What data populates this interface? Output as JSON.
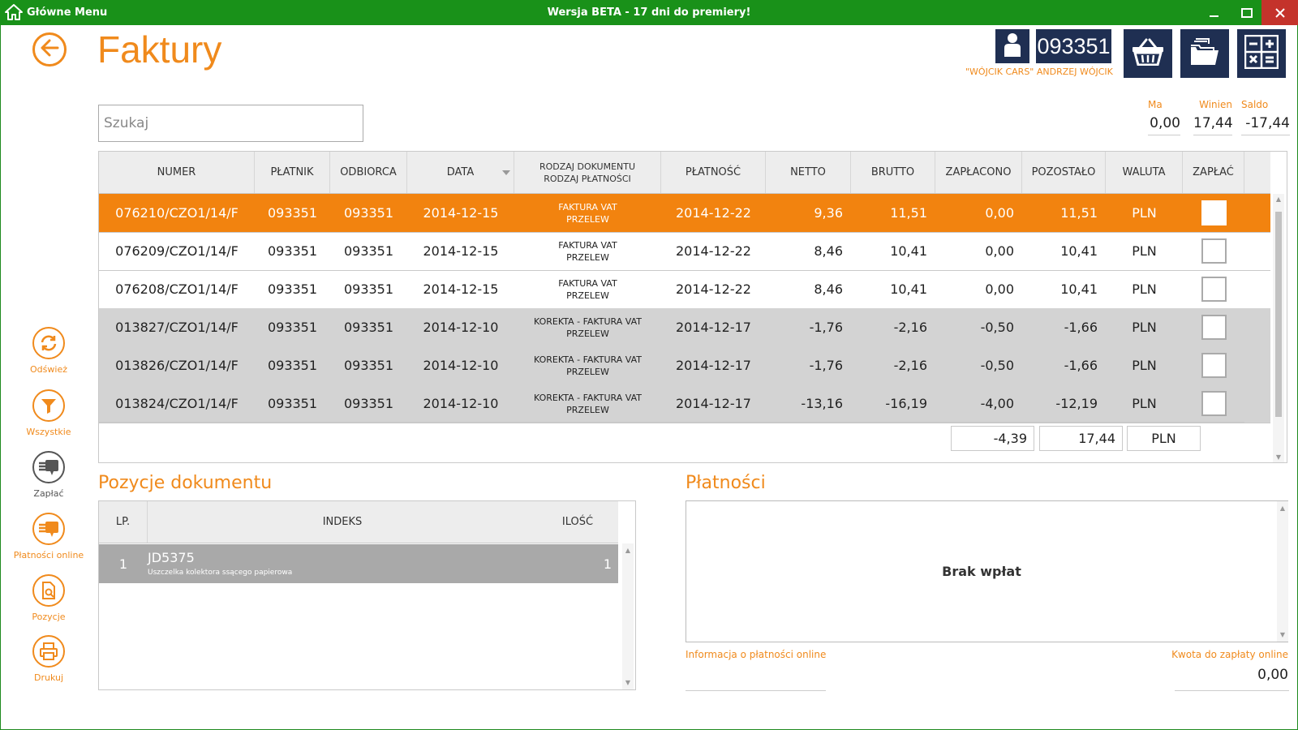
{
  "window": {
    "menu_label": "Główne Menu",
    "title": "Wersja BETA - 17 dni do premiery!"
  },
  "page": {
    "title": "Faktury"
  },
  "customer": {
    "code": "093351",
    "name": "\"WÓJCIK  CARS\" ANDRZEJ WÓJCIK"
  },
  "search": {
    "placeholder": "Szukaj"
  },
  "summary": {
    "ma_label": "Ma",
    "ma_value": "0,00",
    "winien_label": "Winien",
    "winien_value": "17,44",
    "saldo_label": "Saldo",
    "saldo_value": "-17,44"
  },
  "sidebar": {
    "refresh": "Odśwież",
    "all": "Wszystkie",
    "pay": "Zapłać",
    "online": "Płatności online",
    "positions": "Pozycje",
    "print": "Drukuj"
  },
  "invoices": {
    "headers": {
      "numer": "NUMER",
      "platnik": "PŁATNIK",
      "odbiorca": "ODBIORCA",
      "data": "DATA",
      "rodzaj1": "RODZAJ DOKUMENTU",
      "rodzaj2": "RODZAJ PŁATNOŚCI",
      "platnosc": "PŁATNOŚĆ",
      "netto": "NETTO",
      "brutto": "BRUTTO",
      "zaplacono": "ZAPŁACONO",
      "pozostalo": "POZOSTAŁO",
      "waluta": "WALUTA",
      "zaplac": "ZAPŁAĆ"
    },
    "rows": [
      {
        "numer": "076210/CZO1/14/F",
        "platnik": "093351",
        "odbiorca": "093351",
        "data": "2014-12-15",
        "doc": "FAKTURA VAT",
        "pay": "PRZELEW",
        "platnosc": "2014-12-22",
        "netto": "9,36",
        "brutto": "11,51",
        "zaplacono": "0,00",
        "pozostalo": "11,51",
        "waluta": "PLN"
      },
      {
        "numer": "076209/CZO1/14/F",
        "platnik": "093351",
        "odbiorca": "093351",
        "data": "2014-12-15",
        "doc": "FAKTURA VAT",
        "pay": "PRZELEW",
        "platnosc": "2014-12-22",
        "netto": "8,46",
        "brutto": "10,41",
        "zaplacono": "0,00",
        "pozostalo": "10,41",
        "waluta": "PLN"
      },
      {
        "numer": "076208/CZO1/14/F",
        "platnik": "093351",
        "odbiorca": "093351",
        "data": "2014-12-15",
        "doc": "FAKTURA VAT",
        "pay": "PRZELEW",
        "platnosc": "2014-12-22",
        "netto": "8,46",
        "brutto": "10,41",
        "zaplacono": "0,00",
        "pozostalo": "10,41",
        "waluta": "PLN"
      },
      {
        "numer": "013827/CZO1/14/F",
        "platnik": "093351",
        "odbiorca": "093351",
        "data": "2014-12-10",
        "doc": "KOREKTA - FAKTURA VAT",
        "pay": "PRZELEW",
        "platnosc": "2014-12-17",
        "netto": "-1,76",
        "brutto": "-2,16",
        "zaplacono": "-0,50",
        "pozostalo": "-1,66",
        "waluta": "PLN"
      },
      {
        "numer": "013826/CZO1/14/F",
        "platnik": "093351",
        "odbiorca": "093351",
        "data": "2014-12-10",
        "doc": "KOREKTA - FAKTURA VAT",
        "pay": "PRZELEW",
        "platnosc": "2014-12-17",
        "netto": "-1,76",
        "brutto": "-2,16",
        "zaplacono": "-0,50",
        "pozostalo": "-1,66",
        "waluta": "PLN"
      },
      {
        "numer": "013824/CZO1/14/F",
        "platnik": "093351",
        "odbiorca": "093351",
        "data": "2014-12-10",
        "doc": "KOREKTA - FAKTURA VAT",
        "pay": "PRZELEW",
        "platnosc": "2014-12-17",
        "netto": "-13,16",
        "brutto": "-16,19",
        "zaplacono": "-4,00",
        "pozostalo": "-12,19",
        "waluta": "PLN"
      }
    ],
    "totals": {
      "zaplacono": "-4,39",
      "pozostalo": "17,44",
      "waluta": "PLN"
    }
  },
  "positions": {
    "title": "Pozycje dokumentu",
    "headers": {
      "lp": "LP.",
      "indeks": "INDEKS",
      "ilosc": "ILOŚĆ"
    },
    "rows": [
      {
        "lp": "1",
        "indeks": "JD5375",
        "desc": "Uszczelka kolektora ssącego papierowa",
        "ilosc": "1"
      }
    ]
  },
  "payments": {
    "title": "Płatności",
    "empty": "Brak wpłat",
    "online_info": "Informacja o płatności online",
    "amount_label": "Kwota do zapłaty online",
    "amount_value": "0,00"
  },
  "colors": {
    "accent": "#f08a1c",
    "titlebar": "#199119",
    "tile": "#1f2f52",
    "selected_row": "#f2830f",
    "correction_row": "#d3d3d3"
  }
}
